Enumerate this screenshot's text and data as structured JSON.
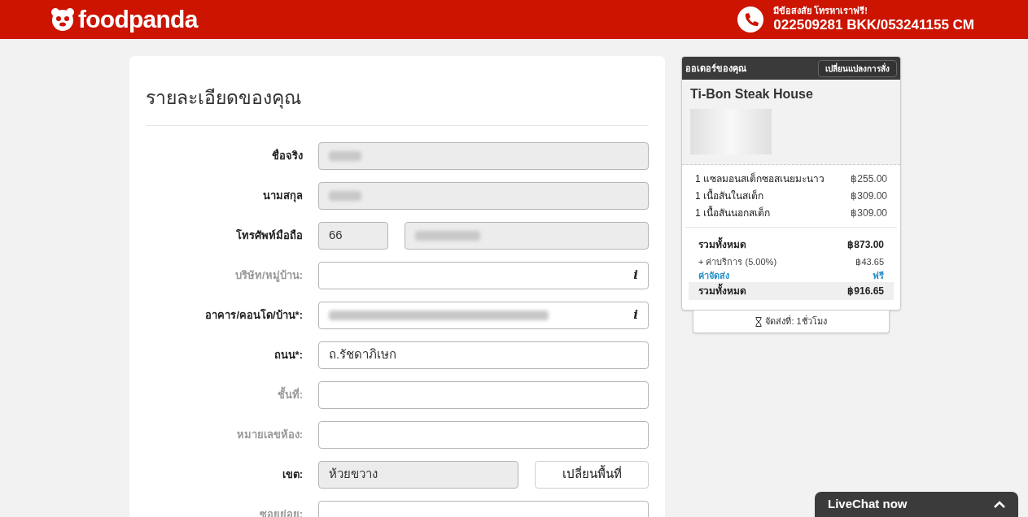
{
  "header": {
    "brand": "foodpanda",
    "help_text": "มีข้อสงสัย โทรหาเราฟรี!",
    "phone": "022509281 BKK/053241155 CM"
  },
  "form": {
    "title": "รายละเอียดของคุณ",
    "rows": [
      {
        "label": "ชื่อจริง",
        "optional": false,
        "kind": "blurred"
      },
      {
        "label": "นามสกุล",
        "optional": false,
        "kind": "blurred"
      },
      {
        "label": "โทรศัพท์มือถือ",
        "optional": false,
        "kind": "phone",
        "prefix": "66"
      },
      {
        "label": "บริษัท/หมู่บ้าน:",
        "optional": true,
        "kind": "info_empty",
        "icon": "i"
      },
      {
        "label": "อาคาร/คอนโด/บ้าน*:",
        "optional": false,
        "kind": "info_blurred",
        "icon": "i"
      },
      {
        "label": "ถนน*:",
        "optional": false,
        "kind": "text",
        "value": "ถ.รัชดาภิเษก"
      },
      {
        "label": "ชั้นที่:",
        "optional": true,
        "kind": "empty"
      },
      {
        "label": "หมายเลขห้อง:",
        "optional": true,
        "kind": "empty"
      },
      {
        "label": "เขต:",
        "optional": false,
        "kind": "area",
        "value": "ห้วยขวาง",
        "button": "เปลี่ยนพื้นที่"
      },
      {
        "label": "ซอยย่อย:",
        "optional": true,
        "kind": "empty"
      }
    ]
  },
  "order": {
    "title": "ออเดอร์ของคุณ",
    "change_button": "เปลี่ยนแปลงการสั่ง",
    "restaurant": "Ti-Bon Steak House",
    "items": [
      {
        "qty": "1",
        "name": "แซลมอนสเต็กซอสเนยมะนาว",
        "price": "฿255.00"
      },
      {
        "qty": "1",
        "name": "เนื้อสันในสเต็ก",
        "price": "฿309.00"
      },
      {
        "qty": "1",
        "name": "เนื้อสันนอกสเต็ก",
        "price": "฿309.00"
      }
    ],
    "subtotal": {
      "label": "รวมทั้งหมด",
      "value": "฿873.00"
    },
    "service": {
      "label": "+ ค่าบริการ (5.00%)",
      "value": "฿43.65"
    },
    "delivery": {
      "label": "ค่าจัดส่ง",
      "value": "ฟรี"
    },
    "total": {
      "label": "รวมทั้งหมด",
      "value": "฿916.65"
    },
    "delivery_time": "จัดส่งที่: 1ชั่วโมง"
  },
  "livechat": {
    "label": "LiveChat now"
  }
}
